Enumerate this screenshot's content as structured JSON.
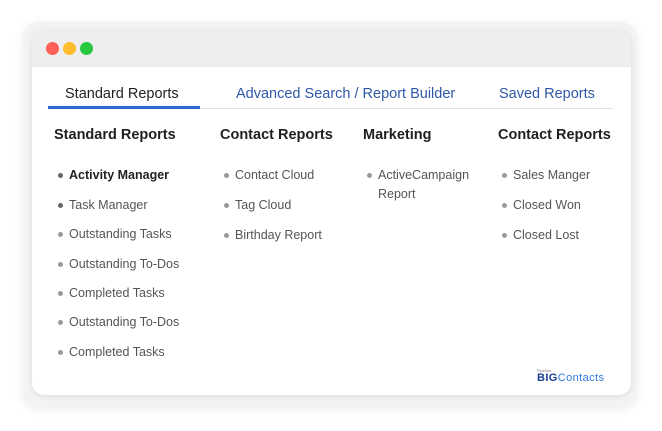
{
  "window": {
    "dots": [
      "#ff5f57",
      "#febc2e",
      "#28c840"
    ]
  },
  "tabs": [
    {
      "label": "Standard Reports",
      "active": true
    },
    {
      "label": "Advanced Search / Report Builder",
      "active": false
    },
    {
      "label": "Saved Reports",
      "active": false
    }
  ],
  "columns": [
    {
      "heading": "Standard Reports",
      "items": [
        "Activity Manager",
        "Task Manager",
        "Outstanding Tasks",
        "Outstanding To-Dos",
        "Completed Tasks",
        "Outstanding To-Dos",
        "Completed Tasks"
      ]
    },
    {
      "heading": "Contact Reports",
      "items": [
        "Contact Cloud",
        "Tag Cloud",
        "Birthday Report"
      ]
    },
    {
      "heading": "Marketing",
      "items": [
        "ActiveCampaign Report"
      ]
    },
    {
      "heading": "Contact Reports",
      "items": [
        "Sales Manger",
        "Closed Won",
        "Closed Lost"
      ]
    }
  ],
  "logo": {
    "sub": "Pipeline",
    "part1": "BIG",
    "part2": "Contacts"
  },
  "colors": {
    "accent": "#2b6cd4",
    "link": "#2f58a8"
  }
}
